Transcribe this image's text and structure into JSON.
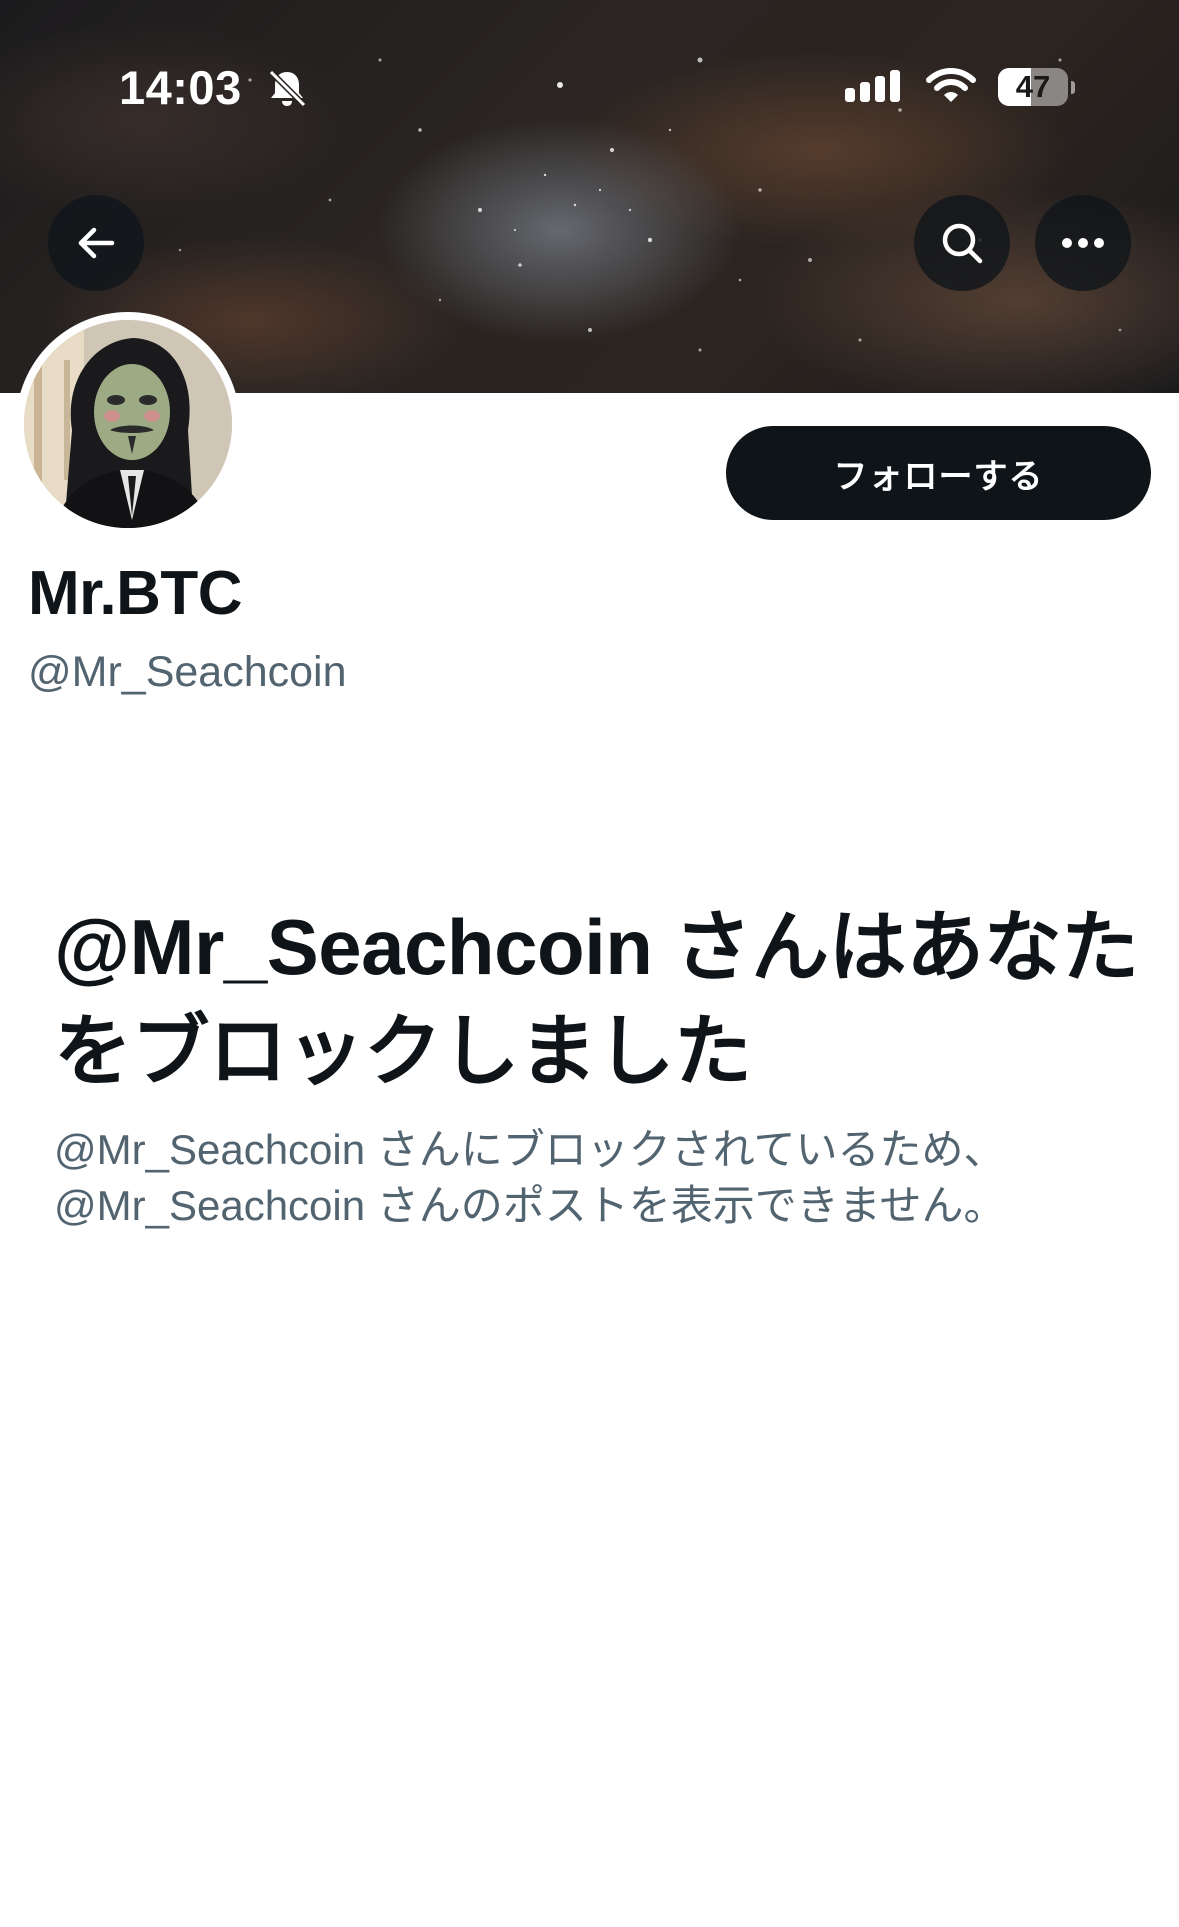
{
  "status_bar": {
    "time": "14:03",
    "battery_level": "47",
    "battery_fraction": 0.47
  },
  "header": {
    "back_icon": "arrow-left-icon",
    "search_icon": "search-icon",
    "more_icon": "more-horizontal-icon"
  },
  "profile": {
    "display_name": "Mr.BTC",
    "handle": "@Mr_Seachcoin",
    "follow_label": "フォローする"
  },
  "blocked_notice": {
    "title": "@Mr_Seachcoin さんはあなたをブロックしました",
    "body": "@Mr_Seachcoin さんにブロックされているため、@Mr_Seachcoin さんのポストを表示できません。"
  },
  "colors": {
    "primary_text": "#0f1419",
    "secondary_text": "#536471",
    "button_bg": "#0f1419",
    "background": "#ffffff"
  }
}
